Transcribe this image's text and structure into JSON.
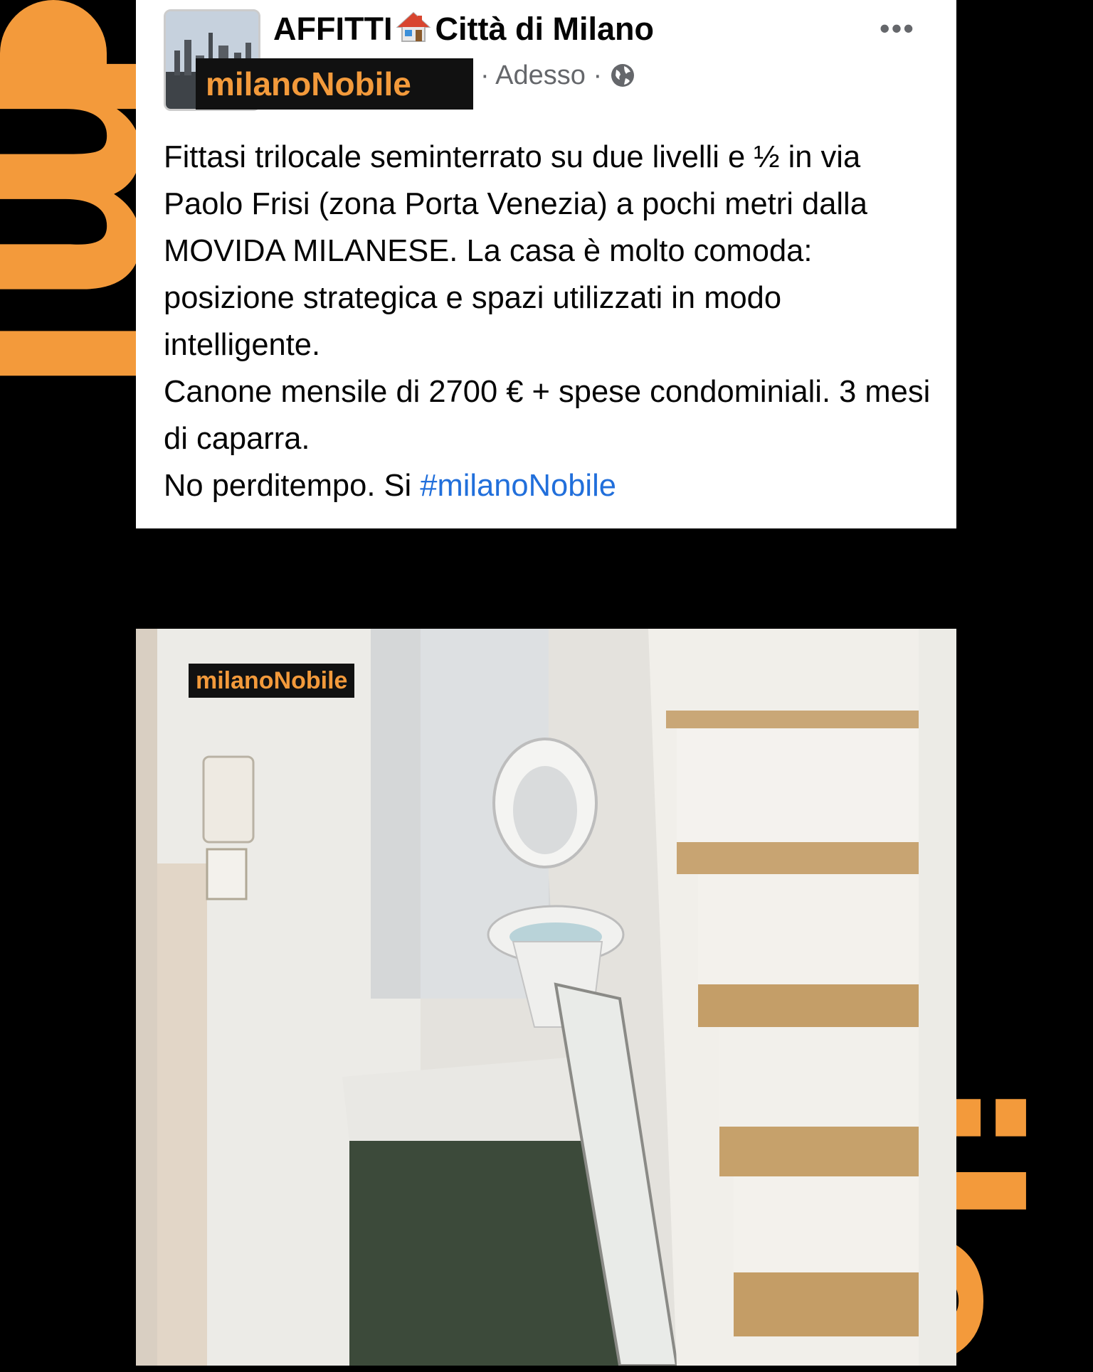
{
  "watermark": {
    "text": "milanoNobile",
    "color": "#f39a3b"
  },
  "post": {
    "group_title_before": "AFFITTI",
    "group_icon": "house-icon",
    "group_title_after": "Città di Milano",
    "author": "milanoNobile",
    "meta_separator": "·",
    "time": "Adesso",
    "privacy_icon": "globe-icon",
    "more_label": "•••",
    "paragraphs": [
      "Fittasi trilocale seminterrato su due livelli e ½ in via Paolo Frisi (zona Porta Venezia) a pochi metri dalla MOVIDA MILANESE. La casa è molto comoda: posizione strategica e spazi utilizzati in modo intelligente.",
      "Canone mensile di 2700 € + spese condominiali. 3 mesi di caparra."
    ],
    "last_line_prefix": "No perditempo. Si",
    "hashtag": "#milanoNobile"
  },
  "photo": {
    "tag": "milanoNobile"
  }
}
